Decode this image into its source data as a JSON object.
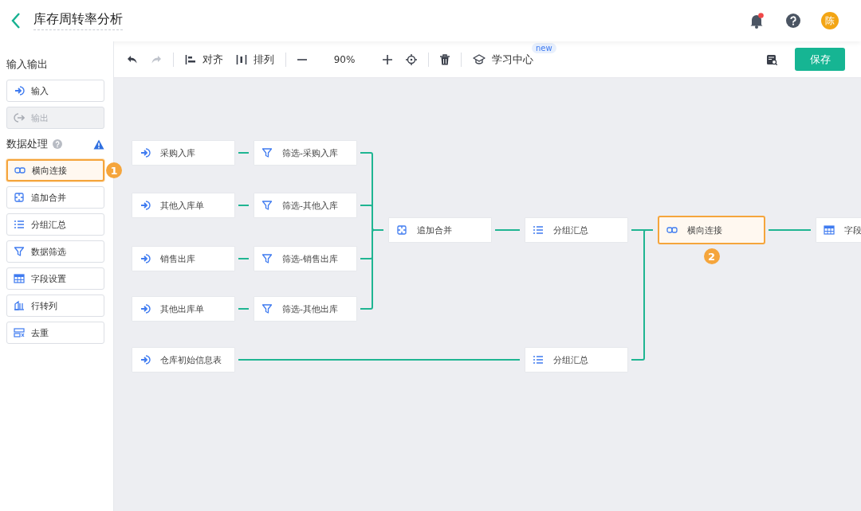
{
  "header": {
    "title": "库存周转率分析",
    "notification_dot": true,
    "avatar": "陈"
  },
  "toolbar": {
    "undo_disabled": false,
    "redo_disabled": true,
    "align": "对齐",
    "arrange": "排列",
    "zoom": "90%",
    "learning": "学习中心",
    "learning_badge": "new",
    "save": "保存"
  },
  "sidebar": {
    "sections": [
      {
        "title": "输入输出",
        "help": false,
        "warning": false,
        "items": [
          {
            "label": "输入",
            "kind": "input",
            "disabled": false,
            "selected": false
          },
          {
            "label": "输出",
            "kind": "output",
            "disabled": true,
            "selected": false
          }
        ]
      },
      {
        "title": "数据处理",
        "help": true,
        "warning": true,
        "items": [
          {
            "label": "横向连接",
            "kind": "join",
            "disabled": false,
            "selected": true,
            "step": "1"
          },
          {
            "label": "追加合并",
            "kind": "append",
            "disabled": false,
            "selected": false
          },
          {
            "label": "分组汇总",
            "kind": "group",
            "disabled": false,
            "selected": false
          },
          {
            "label": "数据筛选",
            "kind": "filter",
            "disabled": false,
            "selected": false
          },
          {
            "label": "字段设置",
            "kind": "fields",
            "disabled": false,
            "selected": false
          },
          {
            "label": "行转列",
            "kind": "pivot",
            "disabled": false,
            "selected": false
          },
          {
            "label": "去重",
            "kind": "dedupe",
            "disabled": false,
            "selected": false
          }
        ]
      }
    ]
  },
  "canvas": {
    "nodes": [
      {
        "label": "采购入库",
        "kind": "input",
        "selected": false
      },
      {
        "label": "筛选-采购入库",
        "kind": "filter",
        "selected": false
      },
      {
        "label": "其他入库单",
        "kind": "input",
        "selected": false
      },
      {
        "label": "筛选-其他入库",
        "kind": "filter",
        "selected": false
      },
      {
        "label": "销售出库",
        "kind": "input",
        "selected": false
      },
      {
        "label": "筛选-销售出库",
        "kind": "filter",
        "selected": false
      },
      {
        "label": "其他出库单",
        "kind": "input",
        "selected": false
      },
      {
        "label": "筛选-其他出库",
        "kind": "filter",
        "selected": false
      },
      {
        "label": "仓库初始信息表",
        "kind": "input",
        "selected": false
      },
      {
        "label": "追加合并",
        "kind": "append",
        "selected": false
      },
      {
        "label": "分组汇总",
        "kind": "group",
        "selected": false
      },
      {
        "label": "分组汇总",
        "kind": "group",
        "selected": false
      },
      {
        "label": "横向连接",
        "kind": "join",
        "selected": true,
        "step": "2"
      },
      {
        "label": "字段",
        "kind": "fields",
        "selected": false
      }
    ]
  }
}
